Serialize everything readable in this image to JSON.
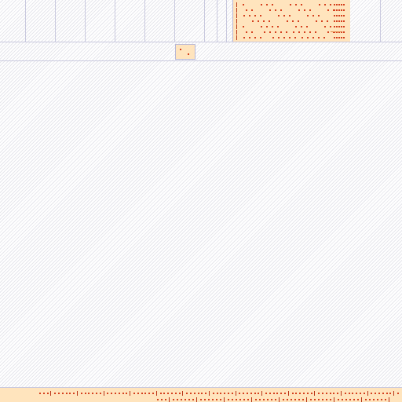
{
  "colors": {
    "background": "#ffffff",
    "hatch": "#e6e6ec",
    "grid_line": "#c9c9de",
    "panel_fill": "#ffe4bd",
    "marker": "#d4411f",
    "marker_dark": "#b83316",
    "dash": "#e48a4a"
  },
  "icons": {
    "panel_markers": "diamond-marker-icon",
    "strip_markers": "diamond-marker-icon"
  },
  "panel": {
    "rows": [
      {
        "name": "panel-row-1",
        "pattern": "dots-right"
      },
      {
        "name": "panel-row-2",
        "pattern": "dots-right"
      },
      {
        "name": "panel-row-3",
        "pattern": "dots-right"
      },
      {
        "name": "panel-row-4",
        "pattern": "dots-right"
      },
      {
        "name": "panel-row-5",
        "pattern": "dots-right"
      },
      {
        "name": "panel-row-6",
        "pattern": "dots-mixed"
      },
      {
        "name": "panel-row-7",
        "pattern": "dots-mixed"
      }
    ]
  },
  "bottom_strip": {
    "rows": [
      {
        "name": "strip-row-1"
      },
      {
        "name": "strip-row-2"
      }
    ]
  }
}
